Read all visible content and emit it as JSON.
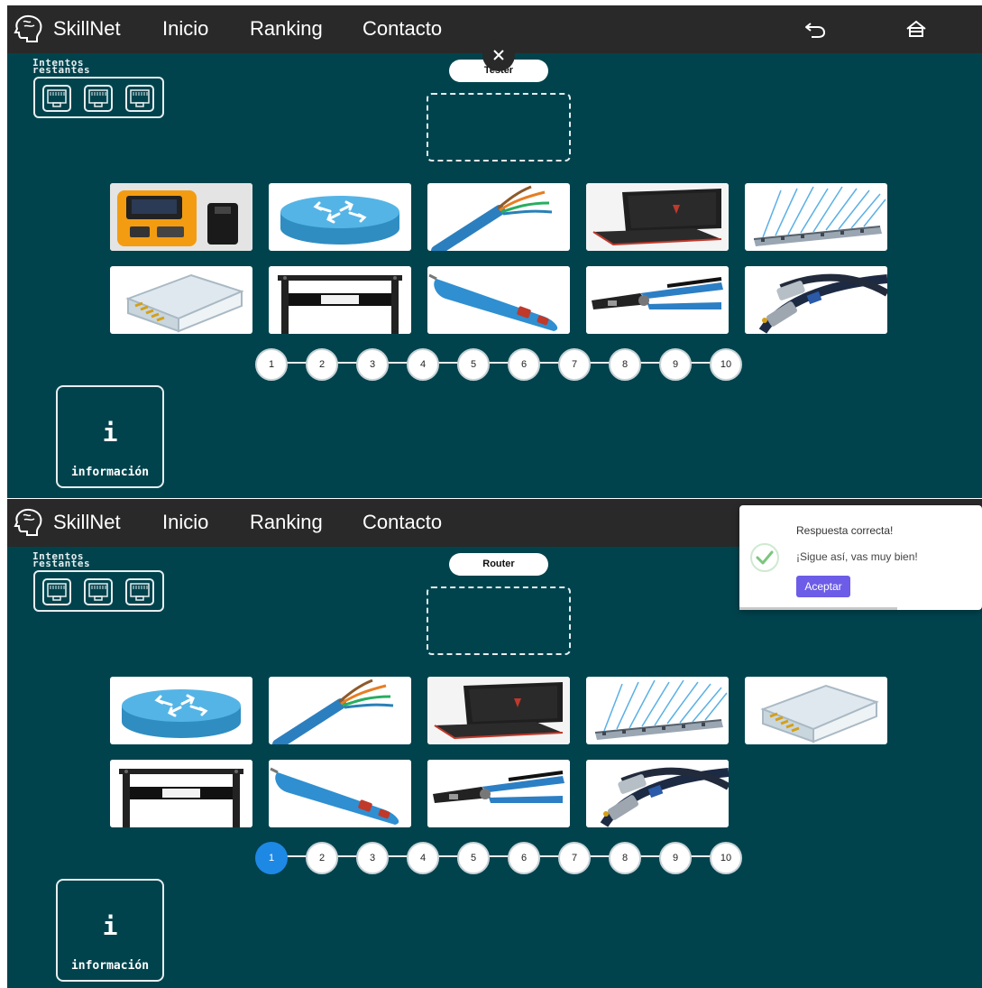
{
  "nav": {
    "brand": "SkillNet",
    "links": [
      "Inicio",
      "Ranking",
      "Contacto"
    ],
    "icons": [
      "brain-logo-icon",
      "undo-icon",
      "home-icon"
    ]
  },
  "game": {
    "attempts_label_line1": "Intentos",
    "attempts_label_line2": "restantes",
    "attempt_icon": "rj45-port-icon",
    "info_icon_text": "i",
    "info_label": "información"
  },
  "screens": [
    {
      "target_label": "Tester",
      "attempts_remaining": 3,
      "cards": [
        "cable-tester",
        "router",
        "utp-cable",
        "laptop",
        "patch-panel",
        "rj45-connector",
        "rack",
        "punch-down-tool",
        "crimping-tool",
        "coaxial-cable"
      ],
      "steps": [
        "1",
        "2",
        "3",
        "4",
        "5",
        "6",
        "7",
        "8",
        "9",
        "10"
      ],
      "active_step": null,
      "overlay": "close-icon"
    },
    {
      "target_label": "Router",
      "attempts_remaining": 3,
      "cards": [
        "router",
        "utp-cable",
        "laptop",
        "patch-panel",
        "rj45-connector",
        "rack",
        "punch-down-tool",
        "crimping-tool",
        "coaxial-cable"
      ],
      "steps": [
        "1",
        "2",
        "3",
        "4",
        "5",
        "6",
        "7",
        "8",
        "9",
        "10"
      ],
      "active_step": "1"
    }
  ],
  "toast": {
    "title": "Respuesta correcta!",
    "message": "¡Sigue así, vas muy bien!",
    "button": "Aceptar",
    "icon": "check-circle-icon"
  },
  "colors": {
    "page_bg": "#00434d",
    "navbar_bg": "#292929",
    "active_step": "#1e88e5",
    "toast_button": "#6c5ce7",
    "success": "#7bc67e"
  }
}
